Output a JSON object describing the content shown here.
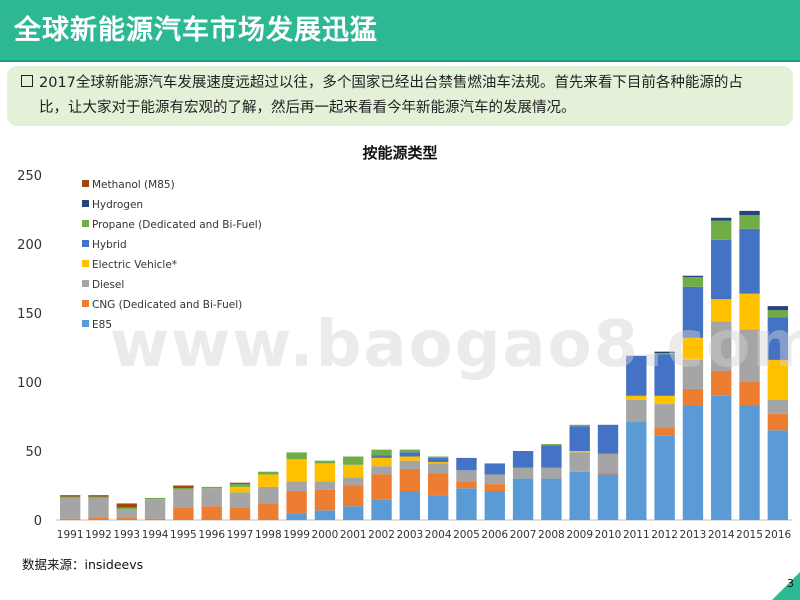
{
  "header": {
    "title": "全球新能源汽车市场发展迅猛"
  },
  "intro": {
    "line1": "2017全球新能源汽车发展速度远超过以往，多个国家已经出台禁售燃油车法规。首先来看下目前各种能源的占",
    "line2": "比，让大家对于能源有宏观的了解，然后再一起来看看今年新能源汽车的发展情况。"
  },
  "source": "数据来源：insideevs",
  "watermark": "www.baogao8.com",
  "page_number": "3",
  "chart_data": {
    "type": "bar",
    "stacked": true,
    "title": "按能源类型",
    "ylim": [
      0,
      250
    ],
    "yticks": [
      0,
      50,
      100,
      150,
      200,
      250
    ],
    "grid": false,
    "legend_position": "top-left",
    "categories": [
      "1991",
      "1992",
      "1993",
      "1994",
      "1995",
      "1996",
      "1997",
      "1998",
      "1999",
      "2000",
      "2001",
      "2002",
      "2003",
      "2004",
      "2005",
      "2006",
      "2007",
      "2008",
      "2009",
      "2010",
      "2011",
      "2012",
      "2013",
      "2014",
      "2015",
      "2016"
    ],
    "series": [
      {
        "name": "E85",
        "color": "#5b9bd5",
        "values": [
          0,
          0,
          0,
          0,
          0,
          0,
          0,
          0,
          5,
          7,
          10,
          15,
          21,
          18,
          23,
          21,
          30,
          30,
          35,
          33,
          71,
          61,
          83,
          90,
          83,
          65
        ]
      },
      {
        "name": "CNG (Dedicated and Bi-Fuel)",
        "color": "#ed7d31",
        "values": [
          1,
          2,
          2,
          1,
          9,
          10,
          9,
          12,
          16,
          15,
          15,
          18,
          16,
          16,
          5,
          5,
          0,
          0,
          0,
          1,
          0,
          6,
          12,
          18,
          17,
          12
        ]
      },
      {
        "name": "Diesel",
        "color": "#a5a5a5",
        "values": [
          15,
          14,
          6,
          14,
          13,
          13,
          11,
          12,
          7,
          6,
          6,
          6,
          6,
          7,
          8,
          7,
          8,
          8,
          14,
          14,
          16,
          17,
          21,
          36,
          38,
          10
        ]
      },
      {
        "name": "Electric Vehicle*",
        "color": "#ffc000",
        "values": [
          0,
          0,
          0,
          0,
          0,
          0,
          4,
          9,
          16,
          13,
          9,
          6,
          3,
          1,
          0,
          0,
          0,
          0,
          1,
          0,
          3,
          6,
          16,
          16,
          26,
          29
        ]
      },
      {
        "name": "Hybrid",
        "color": "#4472c4",
        "values": [
          0,
          0,
          0,
          0,
          0,
          0,
          0,
          0,
          0,
          0,
          0,
          2,
          3,
          3,
          9,
          8,
          12,
          16,
          18,
          21,
          29,
          30,
          37,
          43,
          47,
          31
        ]
      },
      {
        "name": "Propane (Dedicated and Bi-Fuel)",
        "color": "#70ad47",
        "values": [
          1,
          1,
          1,
          1,
          1,
          1,
          2,
          2,
          5,
          2,
          6,
          4,
          2,
          1,
          0,
          0,
          0,
          1,
          1,
          0,
          0,
          1,
          7,
          14,
          10,
          5
        ]
      },
      {
        "name": "Hydrogen",
        "color": "#264478",
        "values": [
          0,
          0,
          0,
          0,
          0,
          0,
          0,
          0,
          0,
          0,
          0,
          0,
          0,
          0,
          0,
          0,
          0,
          0,
          0,
          0,
          0,
          1,
          1,
          2,
          3,
          3
        ]
      },
      {
        "name": "Methanol (M85)",
        "color": "#9e480e",
        "values": [
          1,
          1,
          3,
          0,
          2,
          0,
          1,
          0,
          0,
          0,
          0,
          0,
          0,
          0,
          0,
          0,
          0,
          0,
          0,
          0,
          0,
          0,
          0,
          0,
          0,
          0
        ]
      }
    ]
  }
}
